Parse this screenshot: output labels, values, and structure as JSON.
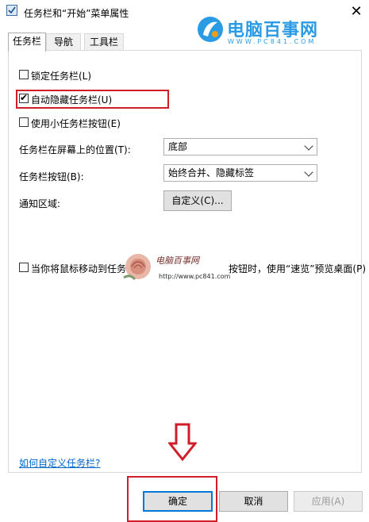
{
  "window": {
    "title": "任务栏和“开始”菜单属性",
    "close_glyph": "✕"
  },
  "watermark": {
    "brand": "电脑百事网",
    "url": "WWW.PC841.COM",
    "overlay_title": "电脑百事网",
    "overlay_url": "http://www.pc841.com"
  },
  "tabs": [
    {
      "label": "任务栏"
    },
    {
      "label": "导航"
    },
    {
      "label": "工具栏"
    }
  ],
  "options": {
    "lock": {
      "label": "锁定任务栏(L)",
      "checked": false
    },
    "autohide": {
      "label": "自动隐藏任务栏(U)",
      "checked": true
    },
    "small_buttons": {
      "label": "使用小任务栏按钮(E)",
      "checked": false
    },
    "position": {
      "label": "任务栏在屏幕上的位置(T):",
      "value": "底部"
    },
    "buttons": {
      "label": "任务栏按钮(B):",
      "value": "始终合并、隐藏标签"
    },
    "notification": {
      "label": "通知区域:",
      "button": "自定义(C)..."
    },
    "peek": {
      "label_start": "当你将鼠标移动到任务",
      "label_end": "按钮时，使用“速览”预览桌面(P)",
      "checked": false
    }
  },
  "footer": {
    "help_link": "如何自定义任务栏?",
    "ok": "确定",
    "cancel": "取消",
    "apply": "应用(A)"
  },
  "colors": {
    "highlight": "#d11d27",
    "link": "#0066cc",
    "accent": "#0078d7",
    "watermark": "#2a9be4"
  }
}
